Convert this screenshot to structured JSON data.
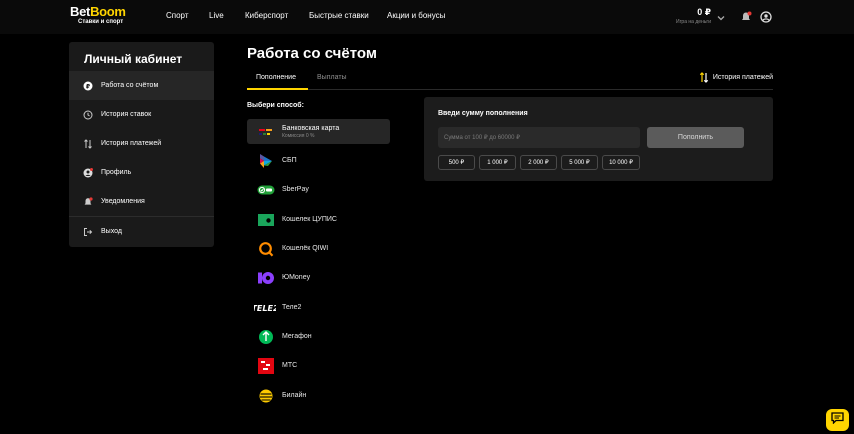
{
  "header": {
    "logo_part1": "Bet",
    "logo_part2": "Boom",
    "logo_sub": "Ставки и спорт",
    "nav": [
      "Спорт",
      "Live",
      "Киберспорт",
      "Быстрые ставки",
      "Акции и бонусы"
    ],
    "balance": "0 ₽",
    "balance_sub": "Игра на деньги"
  },
  "sidebar": {
    "title": "Личный кабинет",
    "items": [
      {
        "label": "Работа со счётом",
        "icon": "ruble-circle-icon"
      },
      {
        "label": "История ставок",
        "icon": "clock-history-icon"
      },
      {
        "label": "История платежей",
        "icon": "swap-arrows-icon"
      },
      {
        "label": "Профиль",
        "icon": "profile-icon"
      },
      {
        "label": "Уведомления",
        "icon": "bell-icon"
      },
      {
        "label": "Выход",
        "icon": "logout-icon"
      }
    ]
  },
  "main": {
    "title": "Работа со счётом",
    "tabs": [
      "Пополнение",
      "Выплаты"
    ],
    "history_link": "История платежей",
    "method_title": "Выбери способ:",
    "methods": [
      {
        "name": "Банковская карта",
        "sub": "Комиссия 0 %"
      },
      {
        "name": "СБП",
        "sub": ""
      },
      {
        "name": "SberPay",
        "sub": ""
      },
      {
        "name": "Кошелек ЦУПИС",
        "sub": ""
      },
      {
        "name": "Кошелёк QIWI",
        "sub": ""
      },
      {
        "name": "ЮMoney",
        "sub": ""
      },
      {
        "name": "Теле2",
        "sub": ""
      },
      {
        "name": "Мегафон",
        "sub": ""
      },
      {
        "name": "МТС",
        "sub": ""
      },
      {
        "name": "Билайн",
        "sub": ""
      }
    ]
  },
  "deposit": {
    "title": "Введи сумму пополнения",
    "placeholder": "Сумма от 100 ₽ до 60000 ₽",
    "button": "Пополнить",
    "quick_amounts": [
      "500 ₽",
      "1 000 ₽",
      "2 000 ₽",
      "5 000 ₽",
      "10 000 ₽"
    ]
  },
  "colors": {
    "accent": "#ffd500",
    "background": "#000000",
    "panel": "#1c1c1c"
  }
}
